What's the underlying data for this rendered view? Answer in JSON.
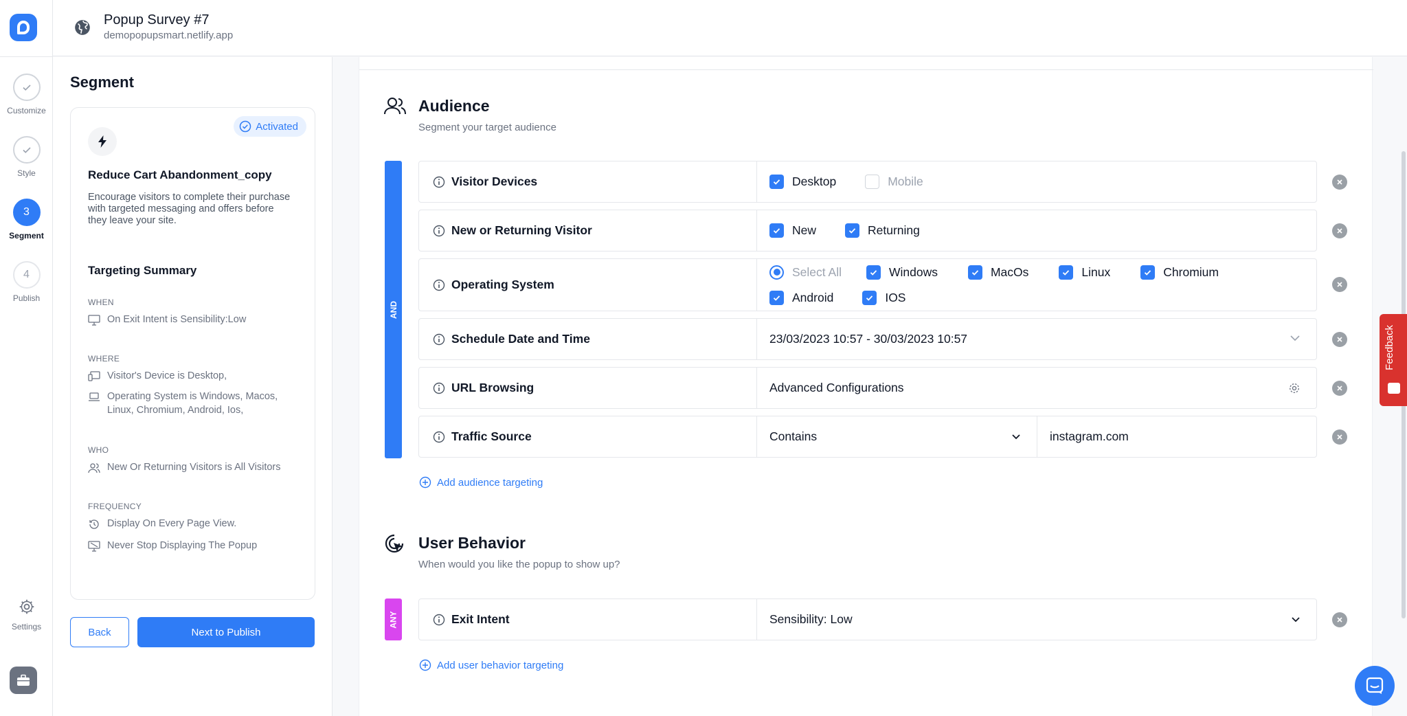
{
  "header": {
    "title": "Popup Survey #7",
    "url": "demopopupsmart.netlify.app"
  },
  "nav": {
    "steps": [
      {
        "label": "Customize",
        "state": "done"
      },
      {
        "label": "Style",
        "state": "done"
      },
      {
        "number": "3",
        "label": "Segment",
        "state": "active"
      },
      {
        "number": "4",
        "label": "Publish",
        "state": "upcoming"
      }
    ],
    "settings_label": "Settings"
  },
  "segment_panel": {
    "title": "Segment",
    "card": {
      "status": "Activated",
      "title": "Reduce Cart Abandonment_copy",
      "description": "Encourage visitors to complete their purchase with targeted messaging and offers before they leave your site."
    },
    "summary": {
      "title": "Targeting Summary",
      "when_heading": "WHEN",
      "when_items": [
        "On Exit Intent is Sensibility:Low"
      ],
      "where_heading": "WHERE",
      "where_items": [
        "Visitor's Device is Desktop,",
        "Operating System is Windows, Macos, Linux, Chromium, Android, Ios,"
      ],
      "who_heading": "WHO",
      "who_items": [
        "New Or Returning Visitors is All Visitors"
      ],
      "frequency_heading": "FREQUENCY",
      "frequency_items": [
        "Display On Every Page View.",
        "Never Stop Displaying The Popup"
      ]
    },
    "back_label": "Back",
    "next_label": "Next to Publish"
  },
  "audience": {
    "title": "Audience",
    "subtitle": "Segment your target audience",
    "logic": "AND",
    "rows": {
      "devices": {
        "label": "Visitor Devices",
        "desktop": "Desktop",
        "mobile": "Mobile"
      },
      "visitor": {
        "label": "New or Returning Visitor",
        "new": "New",
        "returning": "Returning"
      },
      "os": {
        "label": "Operating System",
        "select_all": "Select All",
        "windows": "Windows",
        "macos": "MacOs",
        "linux": "Linux",
        "chromium": "Chromium",
        "android": "Android",
        "ios": "IOS"
      },
      "schedule": {
        "label": "Schedule Date and Time",
        "value": "23/03/2023 10:57 - 30/03/2023 10:57"
      },
      "url": {
        "label": "URL Browsing",
        "value": "Advanced Configurations"
      },
      "traffic": {
        "label": "Traffic Source",
        "operator": "Contains",
        "value": "instagram.com"
      }
    },
    "add_label": "Add audience targeting"
  },
  "behavior": {
    "title": "User Behavior",
    "subtitle": "When would you like the popup to show up?",
    "logic": "ANY",
    "exit": {
      "label": "Exit Intent",
      "value": "Sensibility: Low"
    },
    "add_label": "Add user behavior targeting"
  },
  "feedback_label": "Feedback",
  "colors": {
    "accent": "#2f7cf6",
    "any_bar": "#d946ef",
    "feedback": "#d9322e"
  }
}
